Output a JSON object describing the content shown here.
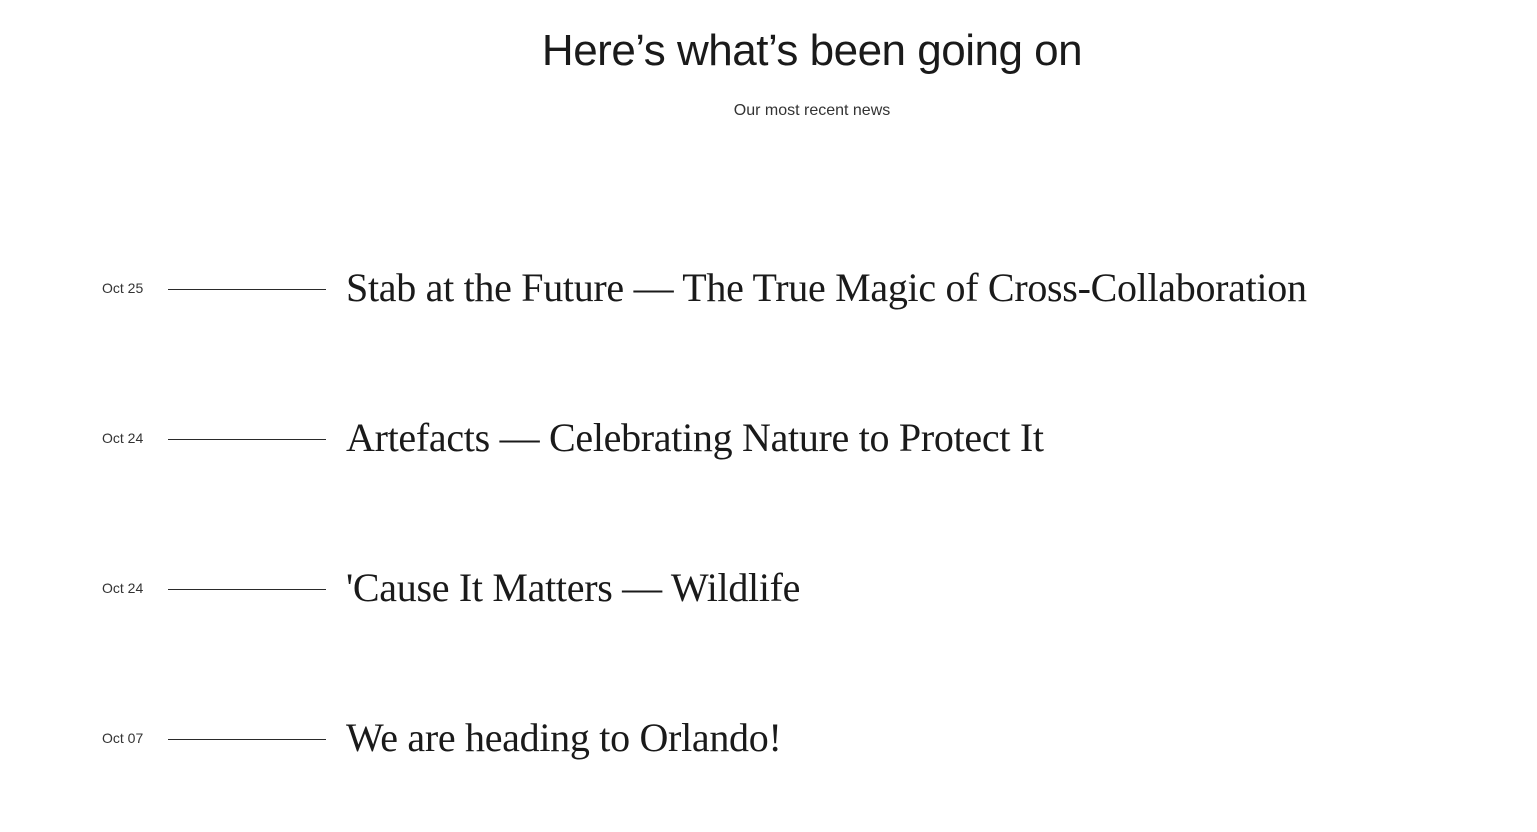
{
  "header": {
    "title": "Here’s what’s been going on",
    "subtitle": "Our most recent news"
  },
  "news": [
    {
      "date": "Oct 25",
      "title": "Stab at the Future — The True Magic of Cross-Collaboration"
    },
    {
      "date": "Oct 24",
      "title": "Artefacts — Celebrating Nature to Protect It"
    },
    {
      "date": "Oct 24",
      "title": "'Cause It Matters — Wildlife"
    },
    {
      "date": "Oct 07",
      "title": "We are heading to Orlando!"
    }
  ]
}
